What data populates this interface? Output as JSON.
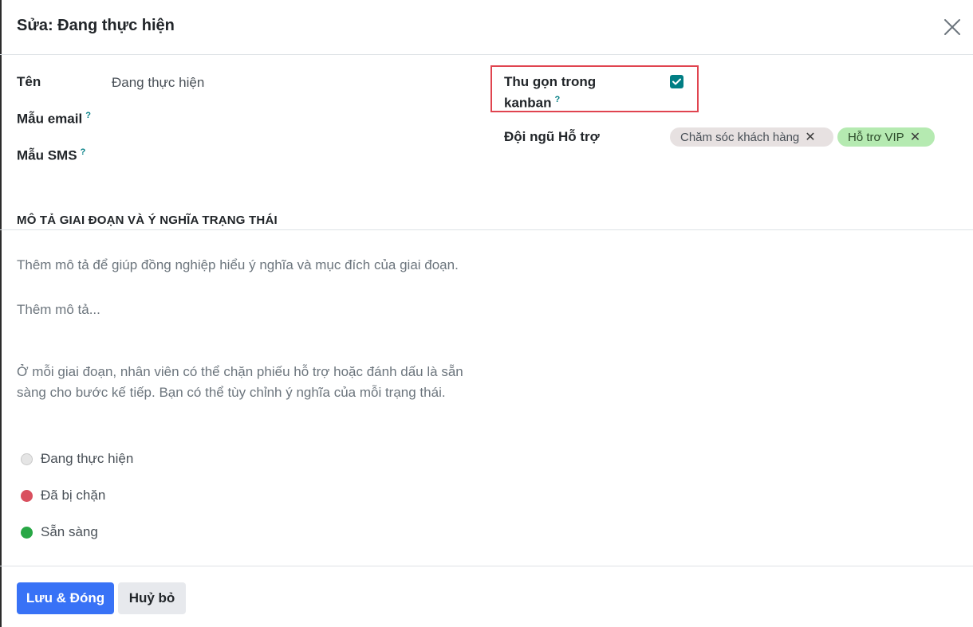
{
  "dialog": {
    "title": "Sửa: Đang thực hiện"
  },
  "form": {
    "name_label": "Tên",
    "name_value": "Đang thực hiện",
    "email_template_label": "Mẫu email",
    "sms_template_label": "Mẫu SMS",
    "help_marker": "?",
    "fold_label_line1": "Thu gọn trong",
    "fold_label_line2": "kanban",
    "fold_checked": true,
    "team_label": "Đội ngũ Hỗ trợ",
    "teams": [
      {
        "label": "Chăm sóc khách hàng",
        "color": "#e7e1e1"
      },
      {
        "label": "Hỗ trơ VIP",
        "color": "#b5eab1"
      }
    ],
    "tag_remove_glyph": "✕"
  },
  "description": {
    "section_title": "MÔ TẢ GIAI ĐOẠN VÀ Ý NGHĨA TRẠNG THÁI",
    "hint": "Thêm mô tả để giúp đồng nghiệp hiểu ý nghĩa và mục đích của giai đoạn.",
    "placeholder": "Thêm mô tả...",
    "states_intro": "Ở mỗi giai đoạn, nhân viên có thể chặn phiếu hỗ trợ hoặc đánh dấu là sẵn sàng cho bước kế tiếp. Bạn có thể tùy chỉnh ý nghĩa của mỗi trạng thái.",
    "states": [
      {
        "label": "Đang thực hiện",
        "color": "#e5e5e5"
      },
      {
        "label": "Đã bị chặn",
        "color": "#d9505f"
      },
      {
        "label": "Sẵn sàng",
        "color": "#28a745"
      }
    ]
  },
  "footer": {
    "save_label": "Lưu & Đóng",
    "cancel_label": "Huỷ bỏ"
  },
  "colors": {
    "primary": "#3872f6",
    "accent": "#017e84",
    "highlight": "#e0444f"
  },
  "icons": {
    "close": "close-icon",
    "checkbox": "check-icon"
  }
}
